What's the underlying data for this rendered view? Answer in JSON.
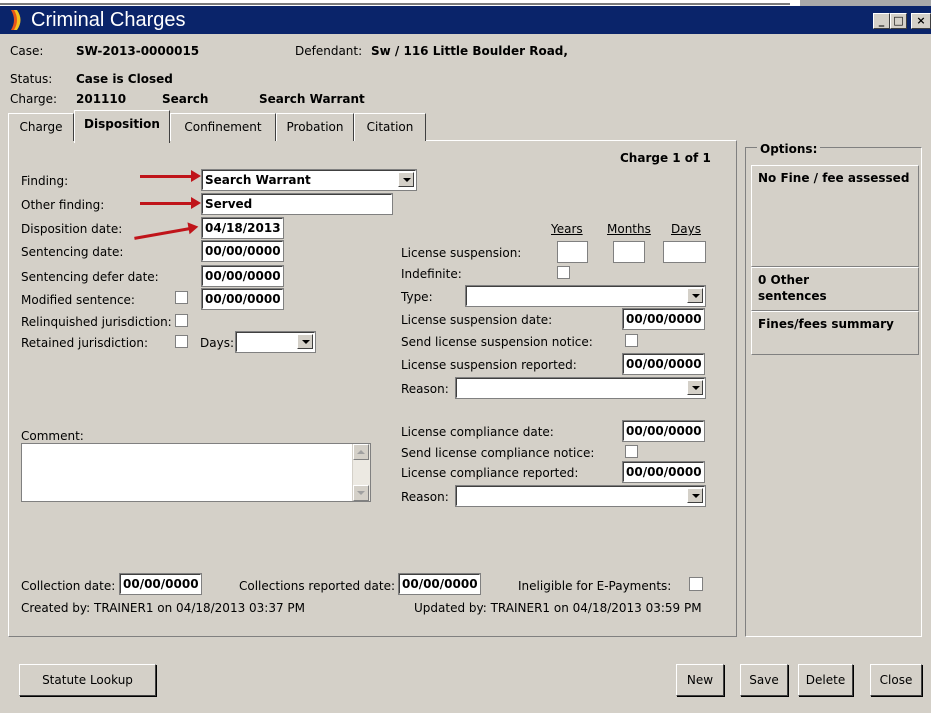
{
  "window": {
    "title": "Criminal Charges",
    "minimize": "_",
    "maximize": "□",
    "close": "×"
  },
  "header": {
    "case_label": "Case:",
    "case_value": "SW-2013-0000015",
    "defendant_label": "Defendant:",
    "defendant_value": "Sw / 116 Little Boulder Road,",
    "status_label": "Status:",
    "status_value": "Case is Closed",
    "charge_label": "Charge:",
    "charge_code": "201110",
    "charge_type": "Search",
    "charge_desc": "Search Warrant"
  },
  "tabs": [
    "Charge",
    "Disposition",
    "Confinement",
    "Probation",
    "Citation"
  ],
  "disposition": {
    "charge_count": "Charge 1 of 1",
    "finding_label": "Finding:",
    "finding_value": "Search Warrant",
    "other_finding_label": "Other finding:",
    "other_finding_value": "Served",
    "disposition_date_label": "Disposition date:",
    "disposition_date_value": "04/18/2013",
    "sentencing_date_label": "Sentencing date:",
    "sentencing_date_value": "00/00/0000",
    "sentencing_defer_label": "Sentencing defer date:",
    "sentencing_defer_value": "00/00/0000",
    "modified_sentence_label": "Modified sentence:",
    "modified_sentence_value": "00/00/0000",
    "relinquished_label": "Relinquished jurisdiction:",
    "retained_label": "Retained jurisdiction:",
    "days_label": "Days:",
    "comment_label": "Comment:",
    "years_label": "Years",
    "months_label": "Months",
    "days_col_label": "Days",
    "license_suspension_label": "License suspension:",
    "indefinite_label": "Indefinite:",
    "type_label": "Type:",
    "license_suspension_date_label": "License suspension date:",
    "license_suspension_date_value": "00/00/0000",
    "send_suspension_notice_label": "Send license suspension notice:",
    "license_suspension_reported_label": "License suspension reported:",
    "license_suspension_reported_value": "00/00/0000",
    "reason_label": "Reason:",
    "license_compliance_date_label": "License compliance date:",
    "license_compliance_date_value": "00/00/0000",
    "send_compliance_notice_label": "Send license compliance notice:",
    "license_compliance_reported_label": "License compliance reported:",
    "license_compliance_reported_value": "00/00/0000",
    "reason2_label": "Reason:",
    "collection_date_label": "Collection date:",
    "collection_date_value": "00/00/0000",
    "collections_reported_label": "Collections reported date:",
    "collections_reported_value": "00/00/0000",
    "ineligible_label": "Ineligible for E-Payments:",
    "created_by": "Created by: TRAINER1 on 04/18/2013 03:37 PM",
    "updated_by": "Updated by: TRAINER1 on 04/18/2013 03:59 PM"
  },
  "options": {
    "title": "Options:",
    "fine_fee": "No Fine / fee assessed",
    "other_sentences_1": "0 Other",
    "other_sentences_2": "sentences",
    "fines_summary": "Fines/fees summary"
  },
  "buttons": {
    "statute_lookup": "Statute Lookup",
    "new": "New",
    "save": "Save",
    "delete": "Delete",
    "close": "Close"
  },
  "colors": {
    "title_bar": "#0a246a",
    "dialog_bg": "#d4d0c8",
    "annotation_arrow": "#c0141a"
  }
}
